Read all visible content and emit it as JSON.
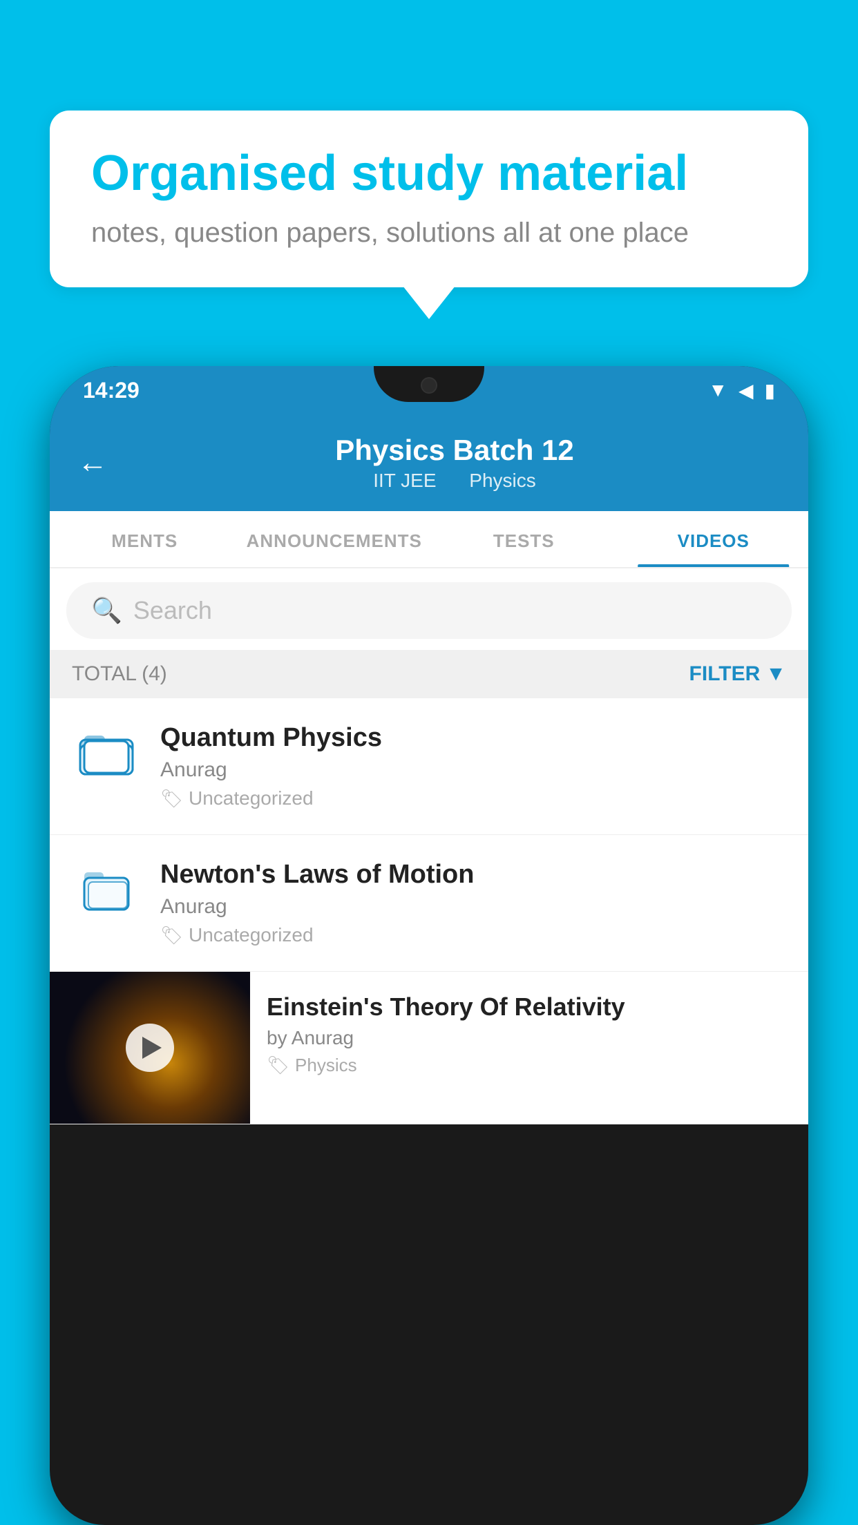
{
  "background_color": "#00BFEA",
  "speech_bubble": {
    "title": "Organised study material",
    "subtitle": "notes, question papers, solutions all at one place"
  },
  "phone": {
    "status_bar": {
      "time": "14:29",
      "icons": [
        "wifi",
        "signal",
        "battery"
      ]
    },
    "header": {
      "title": "Physics Batch 12",
      "tag1": "IIT JEE",
      "tag2": "Physics",
      "back_label": "←"
    },
    "tabs": [
      {
        "label": "MENTS",
        "active": false
      },
      {
        "label": "ANNOUNCEMENTS",
        "active": false
      },
      {
        "label": "TESTS",
        "active": false
      },
      {
        "label": "VIDEOS",
        "active": true
      }
    ],
    "search": {
      "placeholder": "Search"
    },
    "filter_row": {
      "total_label": "TOTAL (4)",
      "filter_label": "FILTER"
    },
    "videos": [
      {
        "title": "Quantum Physics",
        "author": "Anurag",
        "tag": "Uncategorized",
        "has_thumbnail": false
      },
      {
        "title": "Newton's Laws of Motion",
        "author": "Anurag",
        "tag": "Uncategorized",
        "has_thumbnail": false
      },
      {
        "title": "Einstein's Theory Of Relativity",
        "author": "by Anurag",
        "tag": "Physics",
        "has_thumbnail": true
      }
    ]
  }
}
